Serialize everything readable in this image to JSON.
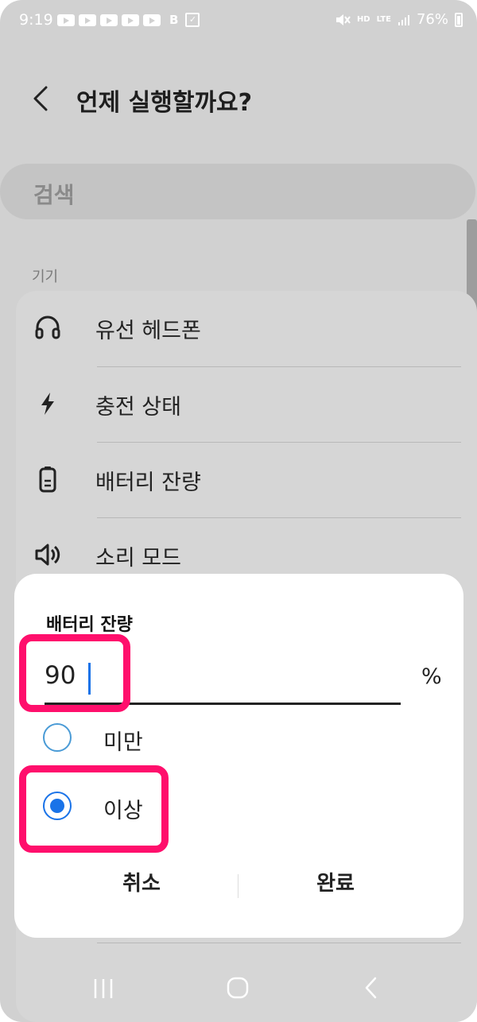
{
  "status_bar": {
    "time": "9:19",
    "b_icon_text": "B",
    "battery_text": "76%",
    "hd_text": "HD",
    "lte_text": "LTE"
  },
  "header": {
    "title": "언제 실행할까요?"
  },
  "search": {
    "placeholder": "검색"
  },
  "section": {
    "label": "기기"
  },
  "list": {
    "items": [
      {
        "label": "유선 헤드폰",
        "icon": "headphones-icon"
      },
      {
        "label": "충전 상태",
        "icon": "lightning-icon"
      },
      {
        "label": "배터리 잔량",
        "icon": "battery-icon"
      },
      {
        "label": "소리 모드",
        "icon": "speaker-icon"
      }
    ]
  },
  "dialog": {
    "title": "배터리 잔량",
    "value": "90",
    "unit": "%",
    "options": [
      {
        "label": "미만",
        "selected": false
      },
      {
        "label": "이상",
        "selected": true
      }
    ],
    "cancel_label": "취소",
    "done_label": "완료"
  },
  "colors": {
    "accent": "#1a73e8",
    "highlight": "#ff0f6c",
    "backdrop": "#d1d1d1"
  }
}
